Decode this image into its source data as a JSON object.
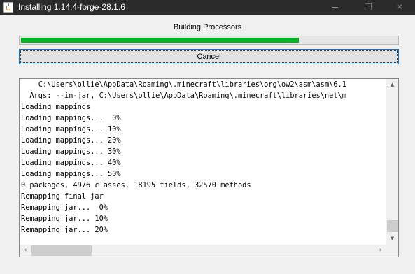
{
  "window": {
    "title": "Installing 1.14.4-forge-28.1.6",
    "icon": "java-icon",
    "controls": {
      "minimize_icon": "minimize-icon",
      "maximize_icon": "maximize-icon",
      "close_icon": "close-icon",
      "close_glyph": "✕"
    }
  },
  "status": {
    "label": "Building Processors"
  },
  "progress": {
    "fraction": 0.74,
    "color": "#06b025"
  },
  "cancel_button": {
    "label": "Cancel"
  },
  "log": {
    "lines": [
      "    C:\\Users\\ollie\\AppData\\Roaming\\.minecraft\\libraries\\org\\ow2\\asm\\asm\\6.1",
      "  Args: --in-jar, C:\\Users\\ollie\\AppData\\Roaming\\.minecraft\\libraries\\net\\m",
      "Loading mappings",
      "Loading mappings...  0%",
      "Loading mappings... 10%",
      "Loading mappings... 20%",
      "Loading mappings... 30%",
      "Loading mappings... 40%",
      "Loading mappings... 50%",
      "0 packages, 4976 classes, 18195 fields, 32570 methods",
      "Remapping final jar",
      "Remapping jar...  0%",
      "Remapping jar... 10%",
      "Remapping jar... 20%"
    ],
    "scroll": {
      "up_glyph": "▲",
      "down_glyph": "▼",
      "left_glyph": "‹",
      "right_glyph": "›"
    }
  }
}
